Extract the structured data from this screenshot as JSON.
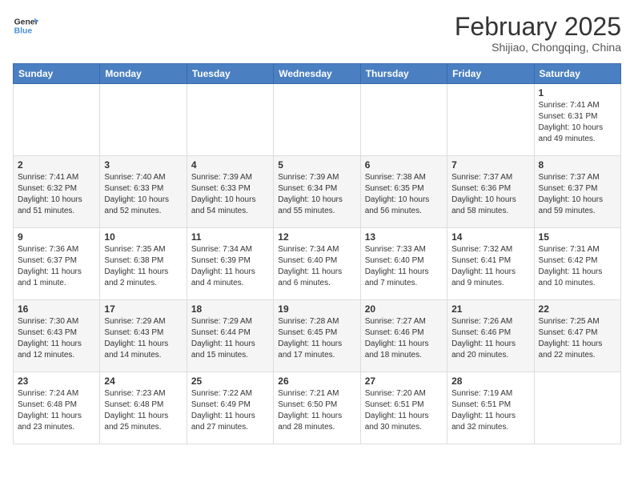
{
  "header": {
    "logo_general": "General",
    "logo_blue": "Blue",
    "month_year": "February 2025",
    "location": "Shijiao, Chongqing, China"
  },
  "weekdays": [
    "Sunday",
    "Monday",
    "Tuesday",
    "Wednesday",
    "Thursday",
    "Friday",
    "Saturday"
  ],
  "weeks": [
    [
      {
        "day": "",
        "info": ""
      },
      {
        "day": "",
        "info": ""
      },
      {
        "day": "",
        "info": ""
      },
      {
        "day": "",
        "info": ""
      },
      {
        "day": "",
        "info": ""
      },
      {
        "day": "",
        "info": ""
      },
      {
        "day": "1",
        "info": "Sunrise: 7:41 AM\nSunset: 6:31 PM\nDaylight: 10 hours\nand 49 minutes."
      }
    ],
    [
      {
        "day": "2",
        "info": "Sunrise: 7:41 AM\nSunset: 6:32 PM\nDaylight: 10 hours\nand 51 minutes."
      },
      {
        "day": "3",
        "info": "Sunrise: 7:40 AM\nSunset: 6:33 PM\nDaylight: 10 hours\nand 52 minutes."
      },
      {
        "day": "4",
        "info": "Sunrise: 7:39 AM\nSunset: 6:33 PM\nDaylight: 10 hours\nand 54 minutes."
      },
      {
        "day": "5",
        "info": "Sunrise: 7:39 AM\nSunset: 6:34 PM\nDaylight: 10 hours\nand 55 minutes."
      },
      {
        "day": "6",
        "info": "Sunrise: 7:38 AM\nSunset: 6:35 PM\nDaylight: 10 hours\nand 56 minutes."
      },
      {
        "day": "7",
        "info": "Sunrise: 7:37 AM\nSunset: 6:36 PM\nDaylight: 10 hours\nand 58 minutes."
      },
      {
        "day": "8",
        "info": "Sunrise: 7:37 AM\nSunset: 6:37 PM\nDaylight: 10 hours\nand 59 minutes."
      }
    ],
    [
      {
        "day": "9",
        "info": "Sunrise: 7:36 AM\nSunset: 6:37 PM\nDaylight: 11 hours\nand 1 minute."
      },
      {
        "day": "10",
        "info": "Sunrise: 7:35 AM\nSunset: 6:38 PM\nDaylight: 11 hours\nand 2 minutes."
      },
      {
        "day": "11",
        "info": "Sunrise: 7:34 AM\nSunset: 6:39 PM\nDaylight: 11 hours\nand 4 minutes."
      },
      {
        "day": "12",
        "info": "Sunrise: 7:34 AM\nSunset: 6:40 PM\nDaylight: 11 hours\nand 6 minutes."
      },
      {
        "day": "13",
        "info": "Sunrise: 7:33 AM\nSunset: 6:40 PM\nDaylight: 11 hours\nand 7 minutes."
      },
      {
        "day": "14",
        "info": "Sunrise: 7:32 AM\nSunset: 6:41 PM\nDaylight: 11 hours\nand 9 minutes."
      },
      {
        "day": "15",
        "info": "Sunrise: 7:31 AM\nSunset: 6:42 PM\nDaylight: 11 hours\nand 10 minutes."
      }
    ],
    [
      {
        "day": "16",
        "info": "Sunrise: 7:30 AM\nSunset: 6:43 PM\nDaylight: 11 hours\nand 12 minutes."
      },
      {
        "day": "17",
        "info": "Sunrise: 7:29 AM\nSunset: 6:43 PM\nDaylight: 11 hours\nand 14 minutes."
      },
      {
        "day": "18",
        "info": "Sunrise: 7:29 AM\nSunset: 6:44 PM\nDaylight: 11 hours\nand 15 minutes."
      },
      {
        "day": "19",
        "info": "Sunrise: 7:28 AM\nSunset: 6:45 PM\nDaylight: 11 hours\nand 17 minutes."
      },
      {
        "day": "20",
        "info": "Sunrise: 7:27 AM\nSunset: 6:46 PM\nDaylight: 11 hours\nand 18 minutes."
      },
      {
        "day": "21",
        "info": "Sunrise: 7:26 AM\nSunset: 6:46 PM\nDaylight: 11 hours\nand 20 minutes."
      },
      {
        "day": "22",
        "info": "Sunrise: 7:25 AM\nSunset: 6:47 PM\nDaylight: 11 hours\nand 22 minutes."
      }
    ],
    [
      {
        "day": "23",
        "info": "Sunrise: 7:24 AM\nSunset: 6:48 PM\nDaylight: 11 hours\nand 23 minutes."
      },
      {
        "day": "24",
        "info": "Sunrise: 7:23 AM\nSunset: 6:48 PM\nDaylight: 11 hours\nand 25 minutes."
      },
      {
        "day": "25",
        "info": "Sunrise: 7:22 AM\nSunset: 6:49 PM\nDaylight: 11 hours\nand 27 minutes."
      },
      {
        "day": "26",
        "info": "Sunrise: 7:21 AM\nSunset: 6:50 PM\nDaylight: 11 hours\nand 28 minutes."
      },
      {
        "day": "27",
        "info": "Sunrise: 7:20 AM\nSunset: 6:51 PM\nDaylight: 11 hours\nand 30 minutes."
      },
      {
        "day": "28",
        "info": "Sunrise: 7:19 AM\nSunset: 6:51 PM\nDaylight: 11 hours\nand 32 minutes."
      },
      {
        "day": "",
        "info": ""
      }
    ]
  ]
}
